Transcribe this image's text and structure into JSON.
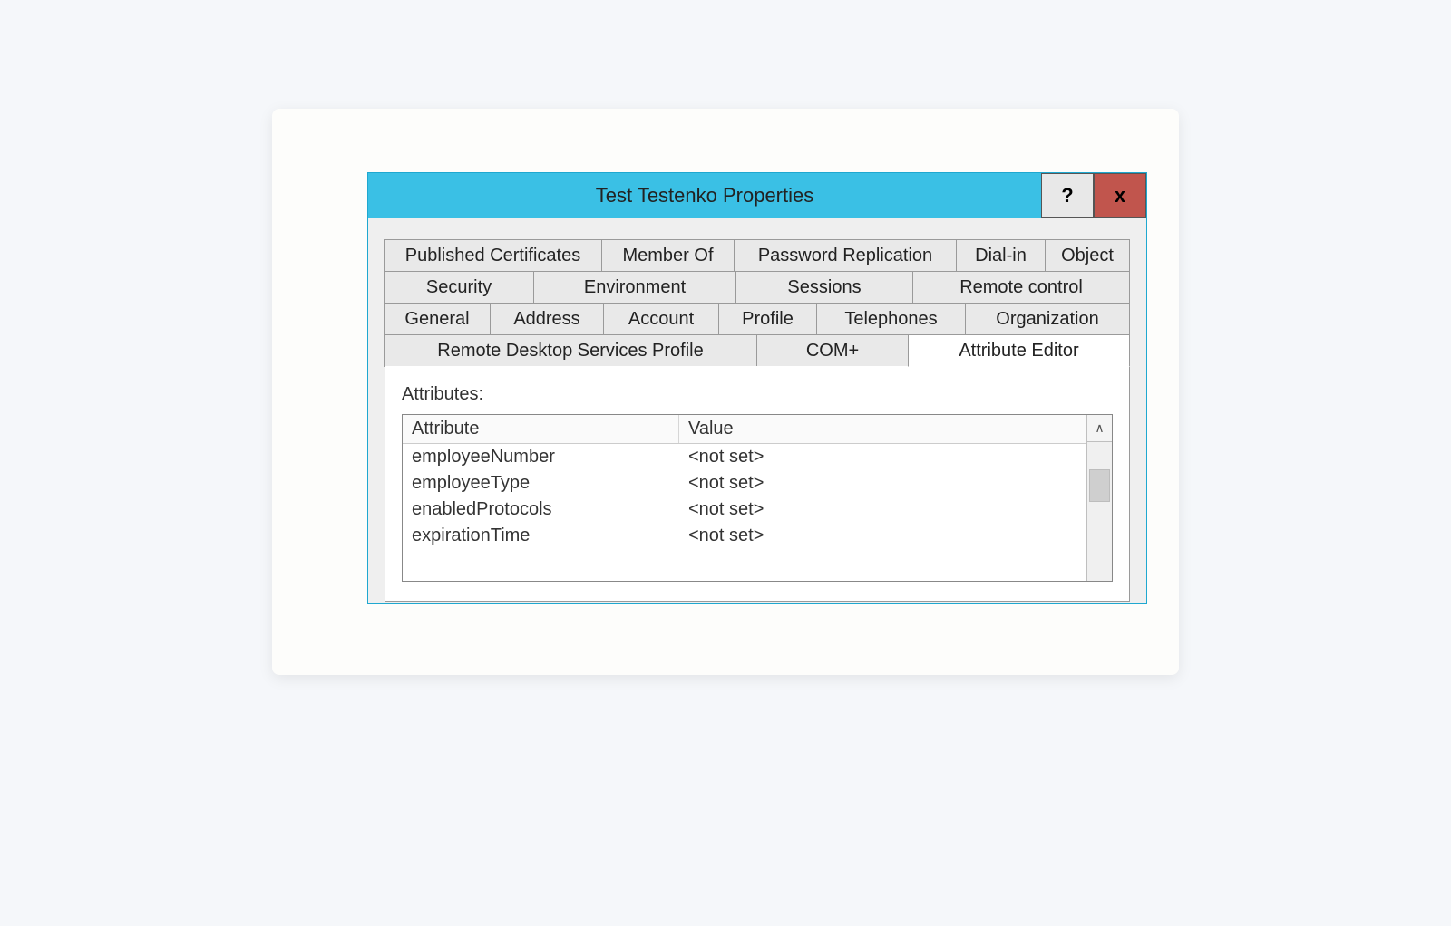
{
  "window": {
    "title": "Test Testenko Properties",
    "help_symbol": "?",
    "close_symbol": "x"
  },
  "tabs": {
    "row1": [
      {
        "label": "Published Certificates"
      },
      {
        "label": "Member Of"
      },
      {
        "label": "Password Replication"
      },
      {
        "label": "Dial-in"
      },
      {
        "label": "Object"
      }
    ],
    "row2": [
      {
        "label": "Security"
      },
      {
        "label": "Environment"
      },
      {
        "label": "Sessions"
      },
      {
        "label": "Remote control"
      }
    ],
    "row3": [
      {
        "label": "General"
      },
      {
        "label": "Address"
      },
      {
        "label": "Account"
      },
      {
        "label": "Profile"
      },
      {
        "label": "Telephones"
      },
      {
        "label": "Organization"
      }
    ],
    "row4": [
      {
        "label": "Remote Desktop Services Profile"
      },
      {
        "label": "COM+"
      },
      {
        "label": "Attribute Editor",
        "active": true
      }
    ]
  },
  "attribute_editor": {
    "section_label": "Attributes:",
    "columns": {
      "attr": "Attribute",
      "val": "Value"
    },
    "rows": [
      {
        "attr": "employeeNumber",
        "val": "<not set>"
      },
      {
        "attr": "employeeType",
        "val": "<not set>"
      },
      {
        "attr": "enabledProtocols",
        "val": "<not set>"
      },
      {
        "attr": "expirationTime",
        "val": "<not set>"
      }
    ],
    "scroll_up_glyph": "∧"
  }
}
